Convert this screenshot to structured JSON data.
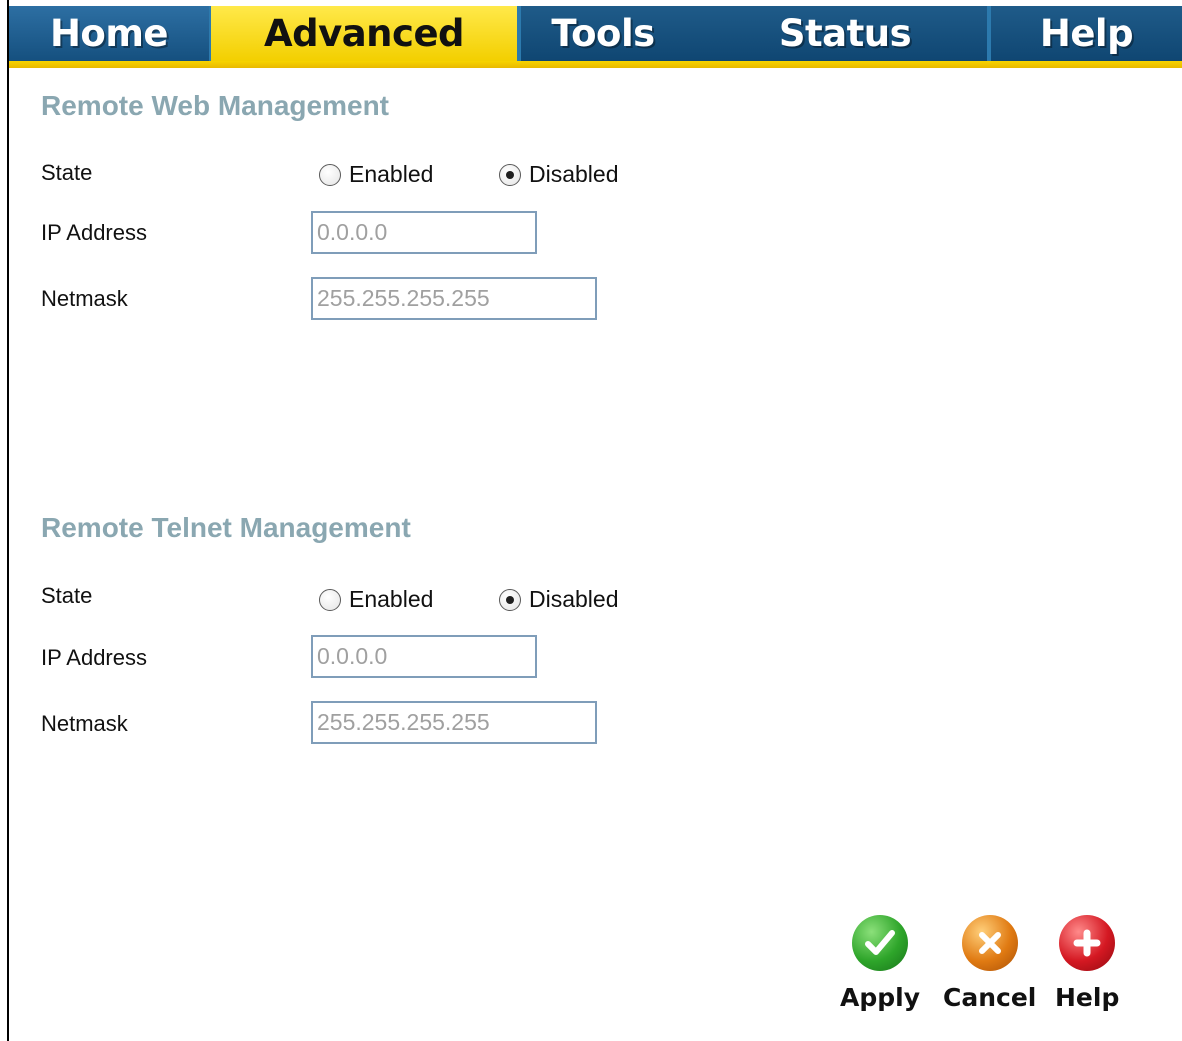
{
  "nav": {
    "tabs": [
      {
        "label": "Home"
      },
      {
        "label": "Advanced"
      },
      {
        "label": "Tools"
      },
      {
        "label": "Status"
      },
      {
        "label": "Help"
      }
    ],
    "active_tab": "Advanced"
  },
  "web": {
    "title": "Remote Web Management",
    "state_label": "State",
    "enabled_label": "Enabled",
    "disabled_label": "Disabled",
    "selected": "Disabled",
    "ip_label": "IP Address",
    "ip_value": "0.0.0.0",
    "netmask_label": "Netmask",
    "netmask_value": "255.255.255.255"
  },
  "telnet": {
    "title": "Remote Telnet Management",
    "state_label": "State",
    "enabled_label": "Enabled",
    "disabled_label": "Disabled",
    "selected": "Disabled",
    "ip_label": "IP Address",
    "ip_value": "0.0.0.0",
    "netmask_label": "Netmask",
    "netmask_value": "255.255.255.255"
  },
  "actions": {
    "apply": "Apply",
    "cancel": "Cancel",
    "help": "Help"
  },
  "colors": {
    "nav_blue": "#15507f",
    "nav_yellow": "#f3cf00",
    "section_title": "#8aa7b1",
    "apply_icon": "#2ea52a",
    "cancel_icon": "#e07a12",
    "help_icon": "#d41822"
  }
}
